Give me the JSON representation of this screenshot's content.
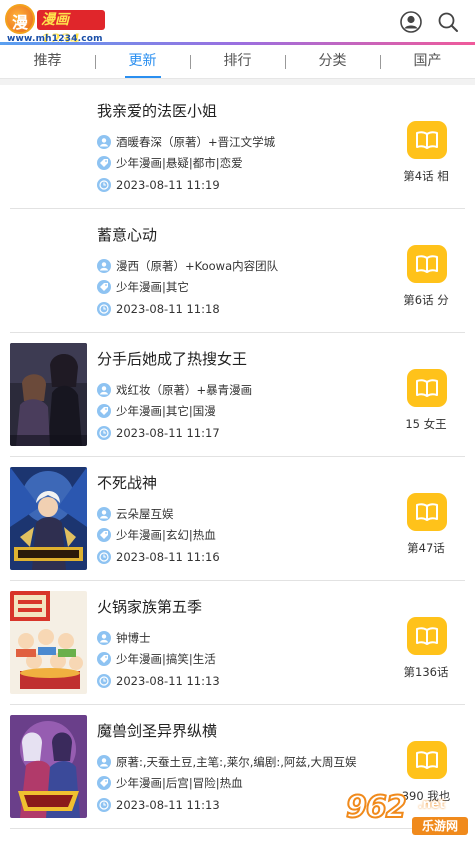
{
  "header": {
    "logo_emblem": "漫",
    "logo_text": "漫画1234",
    "logo_url": "www.mh1234.com"
  },
  "tabs": [
    {
      "label": "推荐",
      "active": false
    },
    {
      "label": "更新",
      "active": true
    },
    {
      "label": "排行",
      "active": false
    },
    {
      "label": "分类",
      "active": false
    },
    {
      "label": "国产",
      "active": false
    }
  ],
  "items": [
    {
      "title": "我亲爱的法医小姐",
      "author": "酒暖春深（原著）+晋江文学城",
      "tags": "少年漫画|悬疑|都市|恋爱",
      "time": "2023-08-11 11:19",
      "latest": "第4话 相",
      "has_cover": false
    },
    {
      "title": "蓄意心动",
      "author": "漫西（原著）+Koowa内容团队",
      "tags": "少年漫画|其它",
      "time": "2023-08-11 11:18",
      "latest": "第6话 分",
      "has_cover": false
    },
    {
      "title": "分手后她成了热搜女王",
      "author": "戏红妆（原著）+暴青漫画",
      "tags": "少年漫画|其它|国漫",
      "time": "2023-08-11 11:17",
      "latest": "15 女王",
      "has_cover": true
    },
    {
      "title": "不死战神",
      "author": "云朵屋互娱",
      "tags": "少年漫画|玄幻|热血",
      "time": "2023-08-11 11:16",
      "latest": "第47话",
      "has_cover": true
    },
    {
      "title": "火锅家族第五季",
      "author": "钟博士",
      "tags": "少年漫画|搞笑|生活",
      "time": "2023-08-11 11:13",
      "latest": "第136话",
      "has_cover": true
    },
    {
      "title": "魔兽剑圣异界纵横",
      "author": "原著:,天蚕土豆,主笔:,莱尔,编剧:,阿兹,大周互娱",
      "tags": "少年漫画|后宫|冒险|热血",
      "time": "2023-08-11 11:13",
      "latest": "390 我也",
      "has_cover": true
    }
  ],
  "watermark": {
    "number": "962",
    "sub": ".net",
    "label": "乐游网"
  },
  "colors": {
    "accent": "#2a8ff0",
    "read_button": "#ffc21a",
    "meta_icon": "#8ec3f2"
  }
}
